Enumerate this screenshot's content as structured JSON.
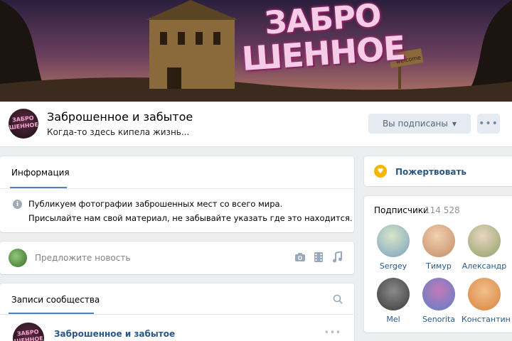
{
  "cover": {
    "title_line1": "ЗАБРО",
    "title_line2": "ШЕННОЕ",
    "sign": "welcome"
  },
  "group": {
    "name": "Заброшенное и забытое",
    "status": "Когда-то здесь кипела жизнь...",
    "avatar_text": "ЗАБРО ШЕННОЕ"
  },
  "actions": {
    "subscribed_label": "Вы подписаны",
    "more_label": "•••"
  },
  "info": {
    "tab_label": "Информация",
    "line1": "Публикуем фотографии заброшенных мест со всего мира.",
    "line2": "Присылайте нам свой материал, не забывайте указать где это находится.",
    "icon": "info-icon"
  },
  "suggest": {
    "placeholder": "Предложите новость",
    "icons": [
      "camera-icon",
      "video-icon",
      "music-icon"
    ]
  },
  "posts": {
    "tab_label": "Записи сообщества",
    "author": "Заброшенное и забытое",
    "more": "•••"
  },
  "donate": {
    "label": "Пожертвовать",
    "icon": "heart-icon"
  },
  "subscribers": {
    "title": "Подписчики",
    "count": "114 528",
    "members": [
      {
        "name": "Sergey",
        "color": "#7aa0c0"
      },
      {
        "name": "Тимур",
        "color": "#c48b63"
      },
      {
        "name": "Александр",
        "color": "#8ea06a"
      },
      {
        "name": "Mel",
        "color": "#3a3a3a"
      },
      {
        "name": "Senorita",
        "color": "#5b7fc8"
      },
      {
        "name": "Константин",
        "color": "#d9833f"
      }
    ]
  },
  "colors": {
    "accent": "#5181b8",
    "link": "#2a5885",
    "background": "#edeef0"
  }
}
